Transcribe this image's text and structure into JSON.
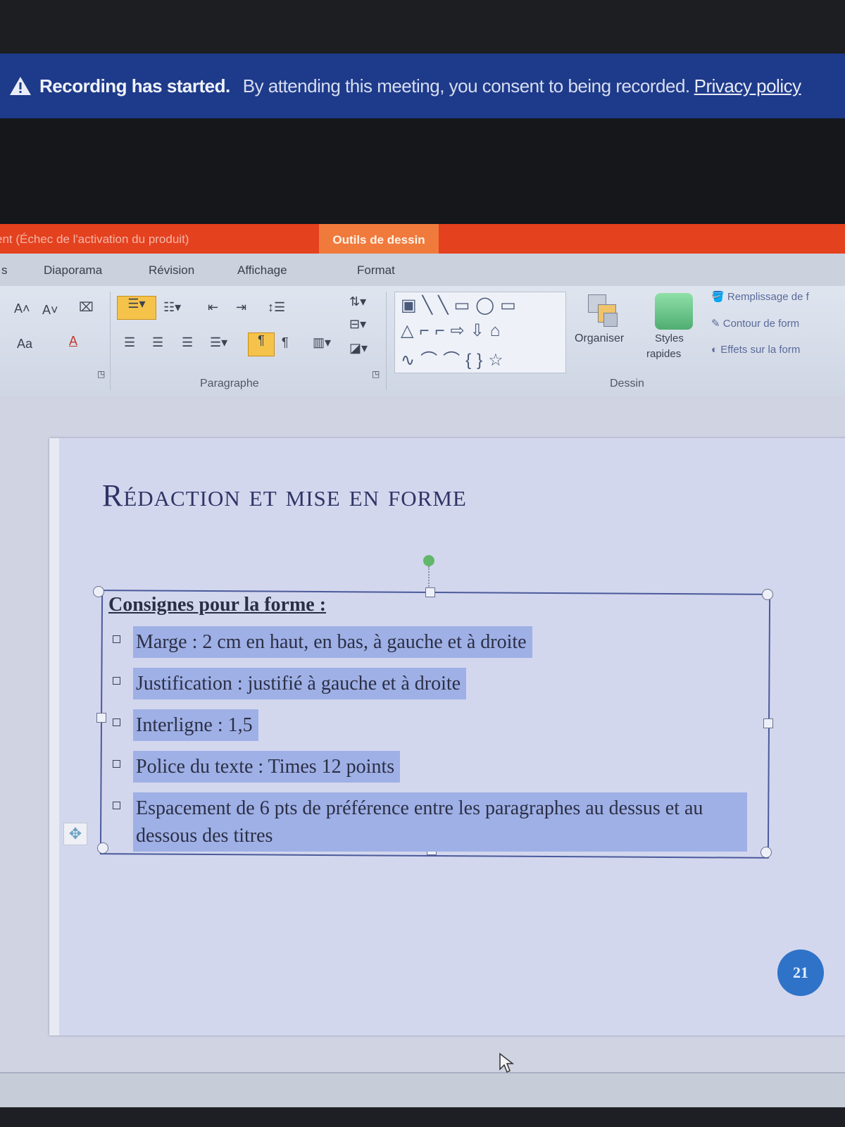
{
  "banner": {
    "title": "Recording has started.",
    "message": "By attending this meeting, you consent to being recorded.",
    "link": "Privacy policy",
    "color": "#1e3a8a"
  },
  "titlebar": {
    "activation_text": "ent (Échec de l'activation du produit)",
    "context_tab": "Outils de dessin",
    "color": "#e4411f"
  },
  "tabs": [
    "Diaporama",
    "Révision",
    "Affichage",
    "Format"
  ],
  "ribbon": {
    "font_buttons": [
      "A˄",
      "A˅",
      "Aa",
      "A"
    ],
    "groups": {
      "paragraph": "Paragraphe",
      "drawing": "Dessin"
    },
    "organiser": "Organiser",
    "styles_rapides_1": "Styles",
    "styles_rapides_2": "rapides",
    "shape_fill": "Remplissage de f",
    "shape_outline": "Contour de form",
    "shape_effects": "Effets sur la form"
  },
  "slide": {
    "title": "Rédaction et mise en forme",
    "heading": "Consignes pour la forme :",
    "bullets": [
      "Marge : 2 cm en haut, en bas, à gauche et à droite",
      "Justification : justifié à gauche et à  droite",
      "Interligne : 1,5",
      "Police du texte : Times 12 points",
      "Espacement  de  6  pts  de  préférence  entre  les  paragraphes  au dessus et au dessous des titres"
    ],
    "page_number": "21",
    "highlight_color": "#9fb0e6"
  }
}
